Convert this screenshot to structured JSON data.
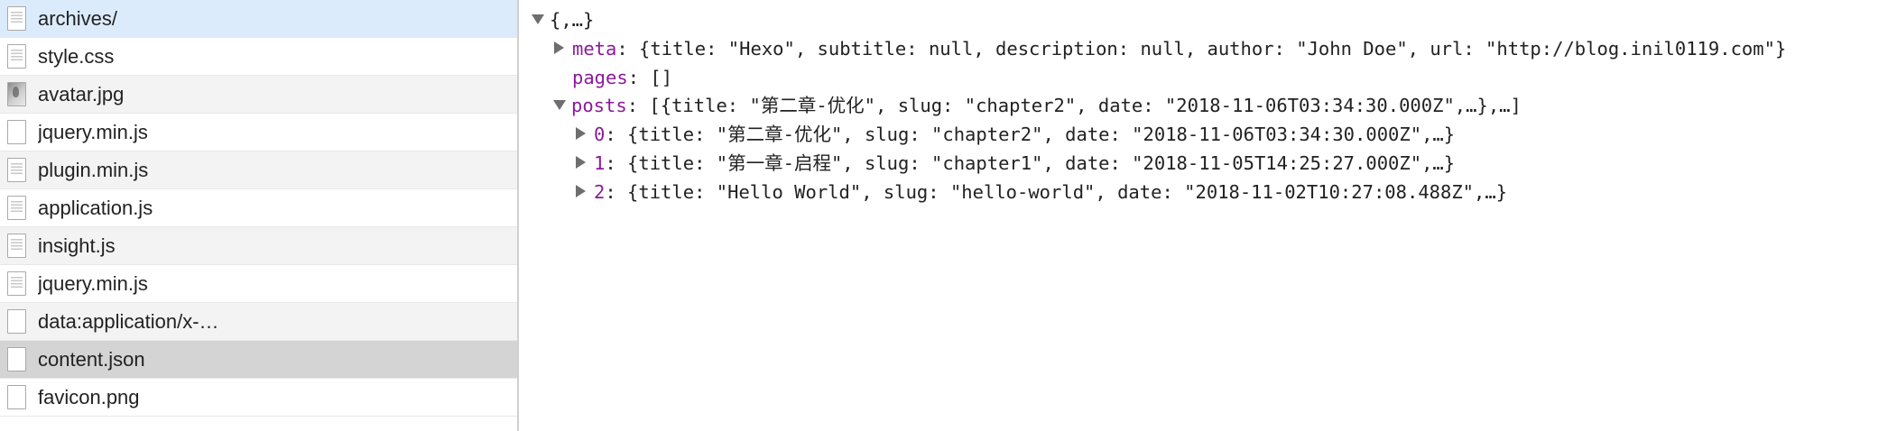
{
  "colors": {
    "key": "#8b1a9b",
    "text": "#222222",
    "row_highlight": "#dcebfc",
    "row_selected": "#d4d4d4",
    "row_alt": "#f3f3f3"
  },
  "files": [
    {
      "name": "archives/",
      "icon": "document-icon",
      "state": "highlight"
    },
    {
      "name": "style.css",
      "icon": "document-icon",
      "state": "odd"
    },
    {
      "name": "avatar.jpg",
      "icon": "image-icon",
      "state": "even"
    },
    {
      "name": "jquery.min.js",
      "icon": "blank-file-icon",
      "state": "odd"
    },
    {
      "name": "plugin.min.js",
      "icon": "document-icon",
      "state": "even"
    },
    {
      "name": "application.js",
      "icon": "document-icon",
      "state": "odd"
    },
    {
      "name": "insight.js",
      "icon": "document-icon",
      "state": "even"
    },
    {
      "name": "jquery.min.js",
      "icon": "document-icon",
      "state": "odd"
    },
    {
      "name": "data:application/x-…",
      "icon": "blank-file-icon",
      "state": "even"
    },
    {
      "name": "content.json",
      "icon": "blank-file-icon",
      "state": "selected"
    },
    {
      "name": "favicon.png",
      "icon": "blank-file-icon",
      "state": "odd"
    }
  ],
  "json_tree": {
    "root": "{,…}",
    "meta_key": "meta",
    "meta_value": ": {title: \"Hexo\", subtitle: null, description: null, author: \"John Doe\", url: \"http://blog.inil0119.com\"}",
    "pages_key": "pages",
    "pages_value": ": []",
    "posts_key": "posts",
    "posts_value": ": [{title: \"第二章-优化\", slug: \"chapter2\", date: \"2018-11-06T03:34:30.000Z\",…},…]",
    "posts_items": [
      {
        "key": "0",
        "value": ": {title: \"第二章-优化\", slug: \"chapter2\", date: \"2018-11-06T03:34:30.000Z\",…}"
      },
      {
        "key": "1",
        "value": ": {title: \"第一章-启程\", slug: \"chapter1\", date: \"2018-11-05T14:25:27.000Z\",…}"
      },
      {
        "key": "2",
        "value": ": {title: \"Hello World\", slug: \"hello-world\", date: \"2018-11-02T10:27:08.488Z\",…}"
      }
    ]
  }
}
